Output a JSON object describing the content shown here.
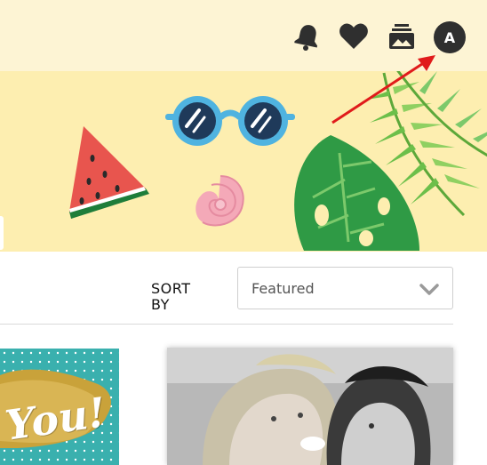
{
  "header": {
    "icons": [
      "bell-icon",
      "heart-icon",
      "gallery-icon"
    ],
    "avatar_initial": "A"
  },
  "banner": {
    "background": "#fdeeb0",
    "decorations": [
      "watermelon-icon",
      "sunglasses-icon",
      "seashell-icon",
      "palm-leaves-icon"
    ]
  },
  "sort": {
    "label": "SORT BY",
    "selected": "Featured"
  },
  "cards": [
    {
      "caption": "You!"
    },
    {
      "caption": ""
    }
  ],
  "colors": {
    "topbar": "#fdf4d4",
    "icon": "#2f2f2f",
    "annotation_arrow": "#e01b1b",
    "card_teal": "#3ab0ae"
  }
}
